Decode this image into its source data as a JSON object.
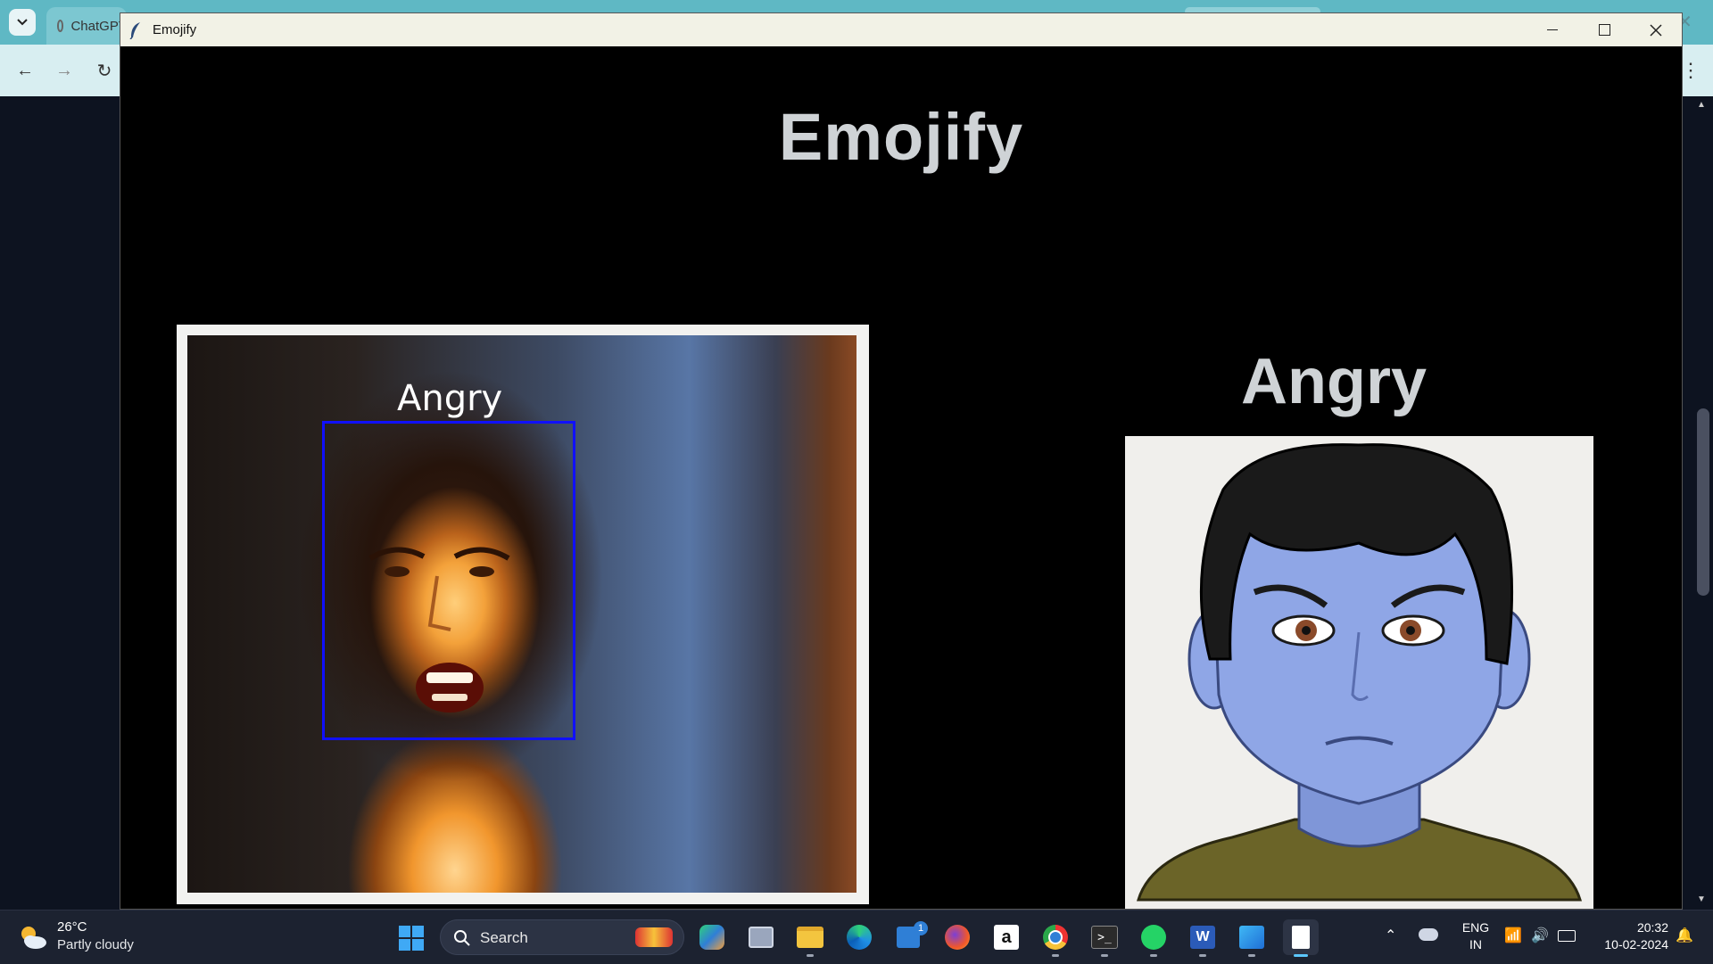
{
  "browser": {
    "tab_label": "ChatGPT",
    "back": "←",
    "forward": "→",
    "reload": "↻",
    "menu": "⋮"
  },
  "window": {
    "title": "Emojify",
    "minimize": "─",
    "maximize": "☐",
    "close": "✕"
  },
  "app": {
    "heading": "Emojify",
    "camera_label": "Angry",
    "emotion_label": "Angry",
    "emoji_avatar": "angry-cartoon-boy-avatar"
  },
  "taskbar": {
    "weather_temp": "26°C",
    "weather_desc": "Partly cloudy",
    "search_placeholder": "Search",
    "store_badge": "1",
    "lang_line1": "ENG",
    "lang_line2": "IN",
    "time": "20:32",
    "date": "10-02-2024"
  },
  "colors": {
    "face_box": "#1010ff",
    "heading_text": "#cfd3d6",
    "avatar_skin": "#8fa6e6",
    "avatar_shirt": "#6b6428"
  }
}
